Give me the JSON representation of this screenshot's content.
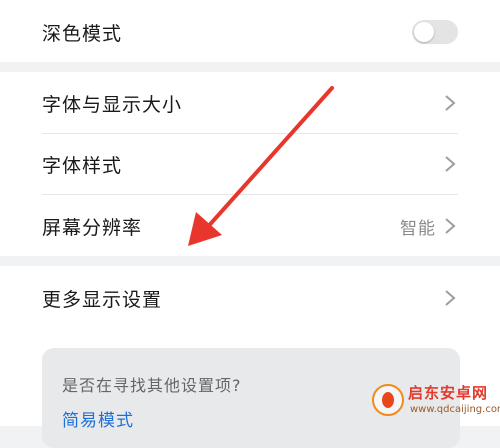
{
  "settings": {
    "dark_mode": {
      "label": "深色模式",
      "enabled": false
    },
    "items": [
      {
        "label": "字体与显示大小",
        "value": ""
      },
      {
        "label": "字体样式",
        "value": ""
      },
      {
        "label": "屏幕分辨率",
        "value": "智能"
      }
    ],
    "more": {
      "label": "更多显示设置"
    }
  },
  "suggestion": {
    "question": "是否在寻找其他设置项?",
    "link": "简易模式"
  },
  "watermark": {
    "name": "启东安卓网",
    "url": "www.qdcaijing.com"
  },
  "colors": {
    "accent_link": "#1f6fd8",
    "arrow": "#e8362c"
  }
}
